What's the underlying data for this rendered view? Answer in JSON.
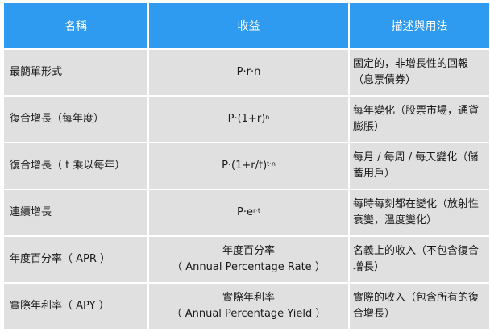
{
  "headers": [
    "名稱",
    "收益",
    "描述與用法"
  ],
  "rows": [
    {
      "name": "最簡單形式",
      "formula": {
        "base": "P·r·n",
        "sup": ""
      },
      "usage": "固定的，非增長性的回報（息票債券）"
    },
    {
      "name": "復合增長（每年度）",
      "formula": {
        "base": "P·(1+r)",
        "sup": "n"
      },
      "usage": "每年變化（股票市場，通貨膨脹）"
    },
    {
      "name": "復合增長（ t 乘以每年）",
      "formula": {
        "base": "P·(1+r/t)",
        "sup": "t·n"
      },
      "usage": "每月 / 每周 / 每天變化（儲蓄用戶）"
    },
    {
      "name": "連續增長",
      "formula": {
        "base": "P·e",
        "sup": "r·t"
      },
      "usage": "每時每刻都在變化（放射性衰變，溫度變化）"
    },
    {
      "name": "年度百分率（ APR ）",
      "formula": {
        "line1": "年度百分率",
        "line2": "（ Annual Percentage Rate ）"
      },
      "usage": "名義上的收入（不包含復合增長）"
    },
    {
      "name": "實際年利率（ APY ）",
      "formula": {
        "line1": "實際年利率",
        "line2": "（ Annual Percentage Yield ）"
      },
      "usage": "實際的收入（包含所有的復合增長）"
    }
  ]
}
